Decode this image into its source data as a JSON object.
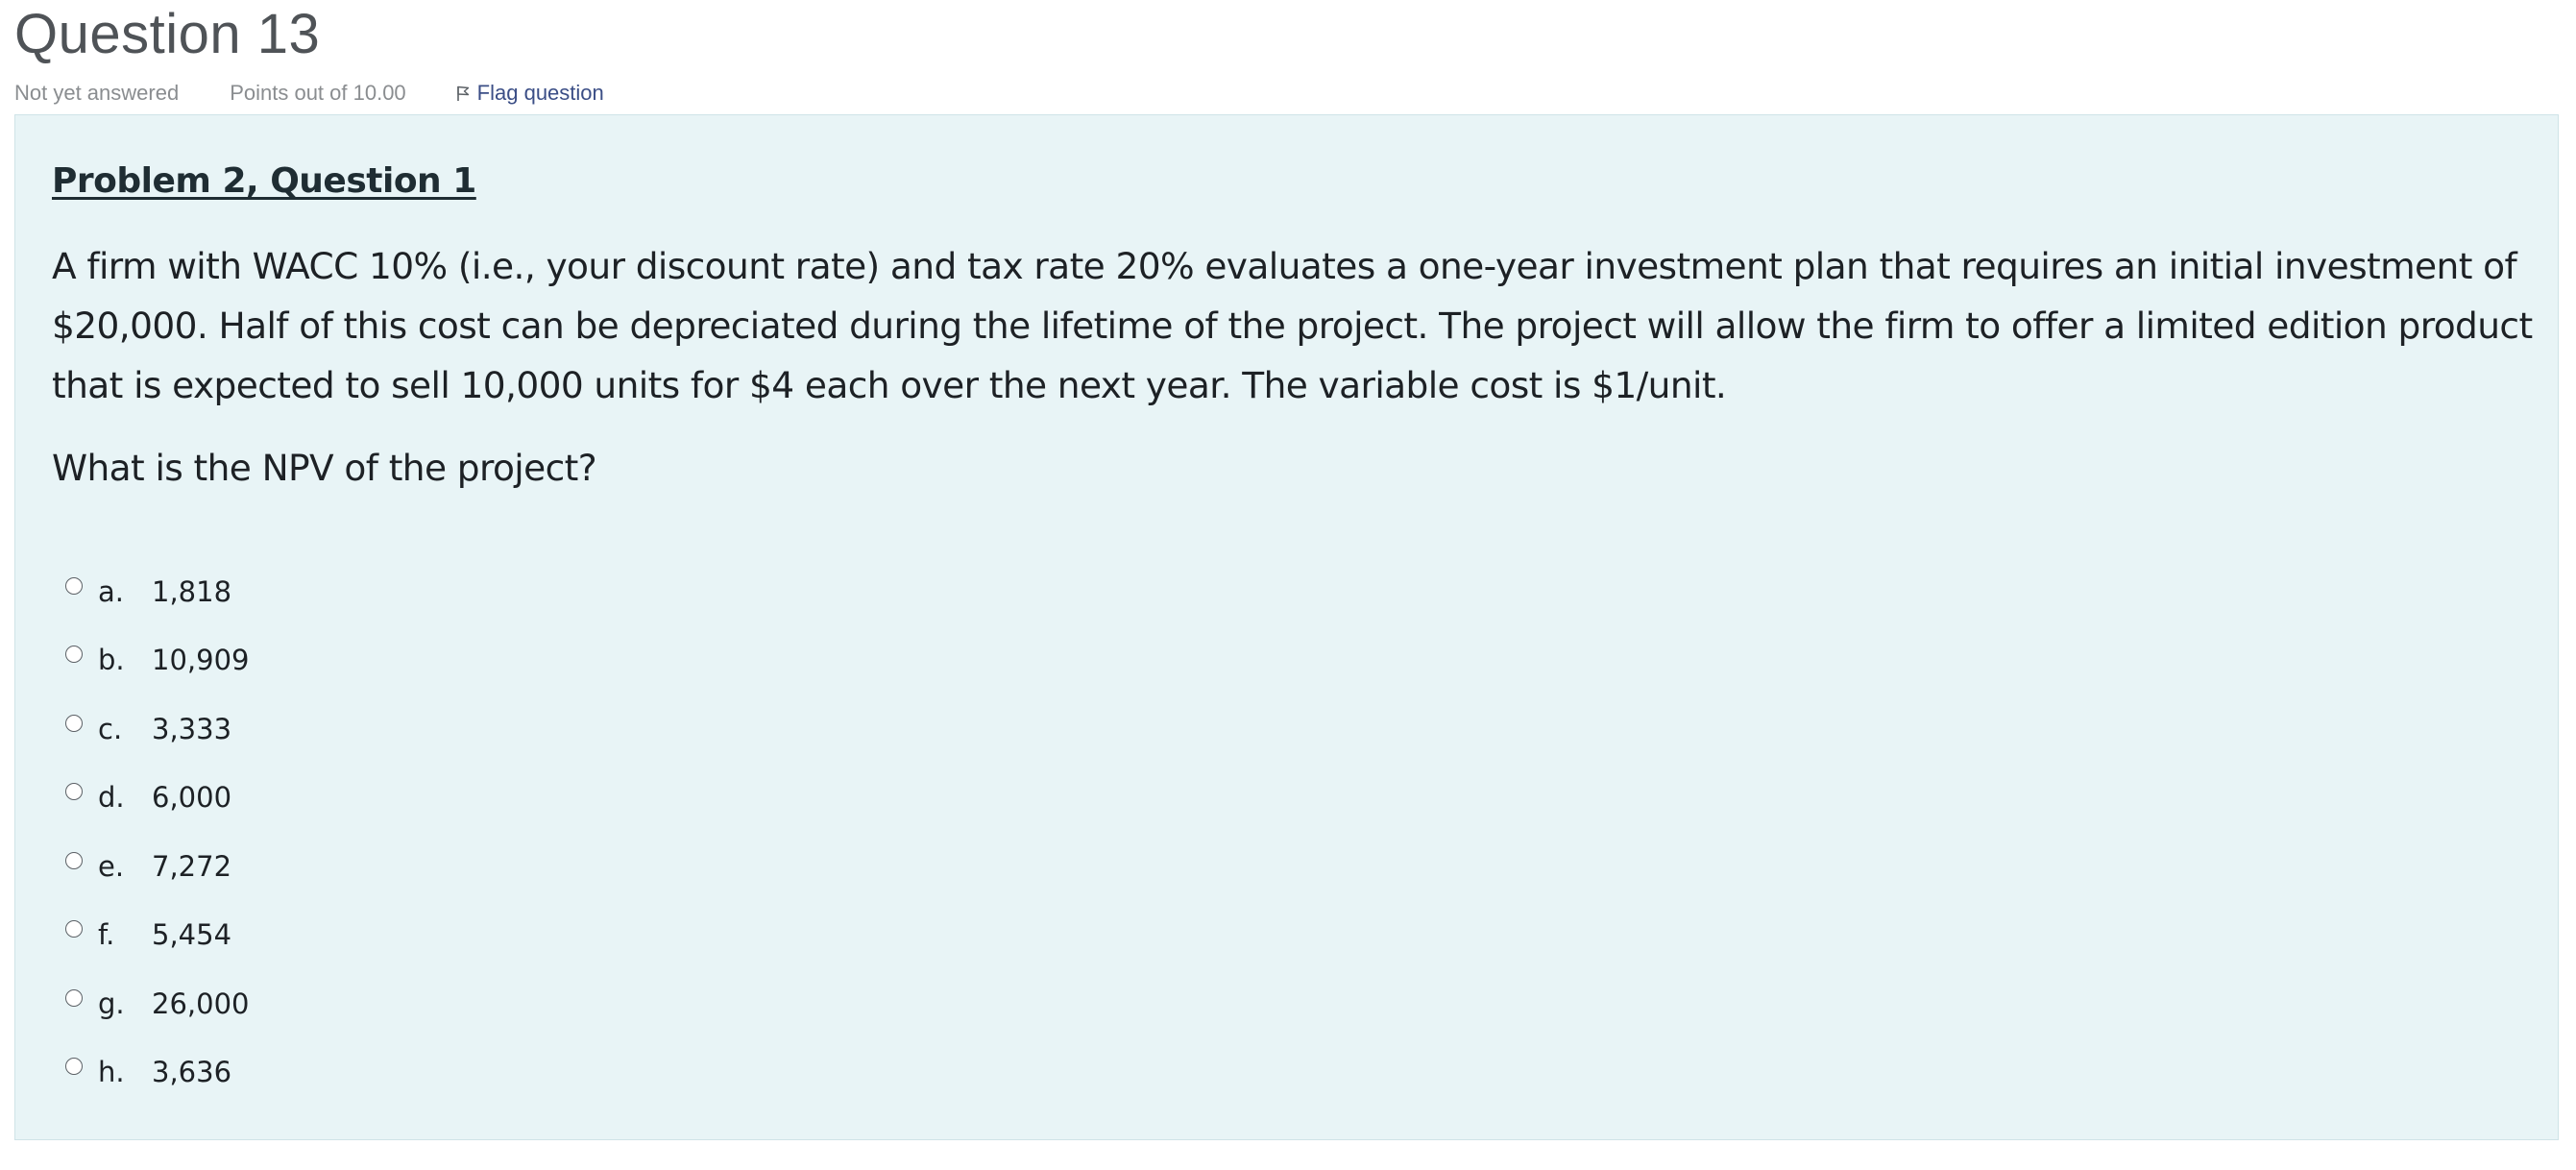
{
  "question": {
    "title": "Question 13",
    "status": "Not yet answered",
    "grade": "Points out of 10.00",
    "flag_label": "Flag question"
  },
  "icons": {
    "flag": "flag-icon"
  },
  "colors": {
    "panel_background": "#e8f4f6",
    "flag_link": "#3b4e86",
    "meta_text": "#8a8d90"
  },
  "content": {
    "heading": "Problem 2, Question 1",
    "problem": "A firm with WACC 10% (i.e., your discount rate) and tax rate 20% evaluates a one-year investment plan that requires an initial investment of $20,000. Half of this cost can be depreciated during the lifetime of the project. The project will allow the firm to offer a limited edition product that is expected to sell 10,000 units for $4 each over the next year. The variable cost is $1/unit.",
    "question": "What is the NPV of the project?"
  },
  "answers": [
    {
      "letter": "a.",
      "value": "1,818"
    },
    {
      "letter": "b.",
      "value": "10,909"
    },
    {
      "letter": "c.",
      "value": "3,333"
    },
    {
      "letter": "d.",
      "value": "6,000"
    },
    {
      "letter": "e.",
      "value": "7,272"
    },
    {
      "letter": "f.",
      "value": "5,454"
    },
    {
      "letter": "g.",
      "value": "26,000"
    },
    {
      "letter": "h.",
      "value": "3,636"
    }
  ]
}
